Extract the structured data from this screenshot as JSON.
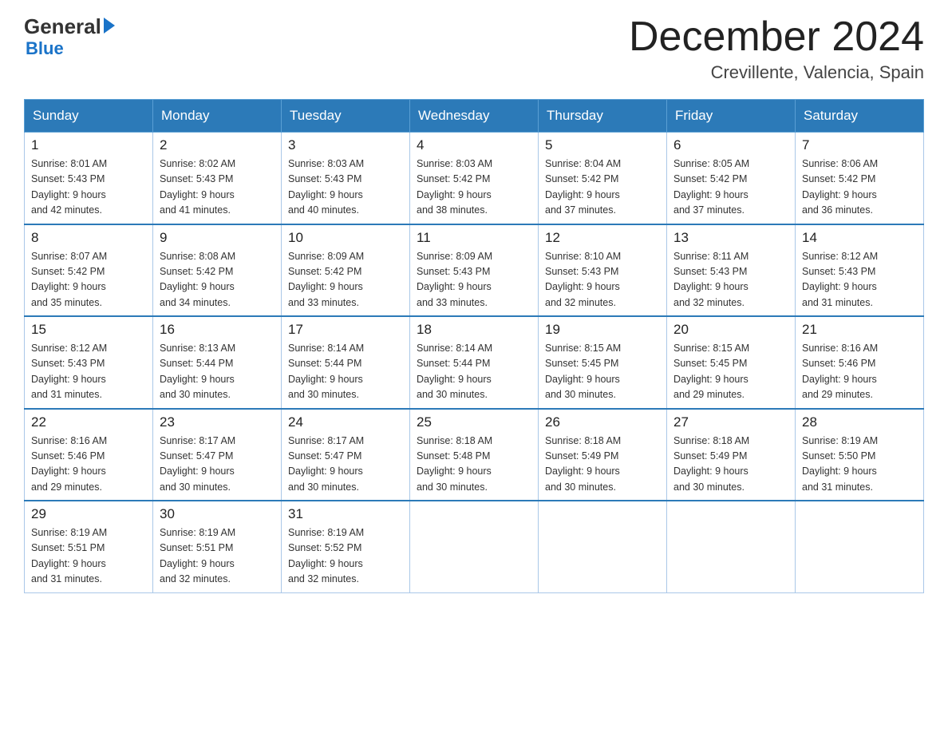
{
  "header": {
    "logo_general": "General",
    "logo_blue": "Blue",
    "month_title": "December 2024",
    "location": "Crevillente, Valencia, Spain"
  },
  "weekdays": [
    "Sunday",
    "Monday",
    "Tuesday",
    "Wednesday",
    "Thursday",
    "Friday",
    "Saturday"
  ],
  "weeks": [
    [
      {
        "day": "1",
        "sunrise": "8:01 AM",
        "sunset": "5:43 PM",
        "daylight": "9 hours and 42 minutes."
      },
      {
        "day": "2",
        "sunrise": "8:02 AM",
        "sunset": "5:43 PM",
        "daylight": "9 hours and 41 minutes."
      },
      {
        "day": "3",
        "sunrise": "8:03 AM",
        "sunset": "5:43 PM",
        "daylight": "9 hours and 40 minutes."
      },
      {
        "day": "4",
        "sunrise": "8:03 AM",
        "sunset": "5:42 PM",
        "daylight": "9 hours and 38 minutes."
      },
      {
        "day": "5",
        "sunrise": "8:04 AM",
        "sunset": "5:42 PM",
        "daylight": "9 hours and 37 minutes."
      },
      {
        "day": "6",
        "sunrise": "8:05 AM",
        "sunset": "5:42 PM",
        "daylight": "9 hours and 37 minutes."
      },
      {
        "day": "7",
        "sunrise": "8:06 AM",
        "sunset": "5:42 PM",
        "daylight": "9 hours and 36 minutes."
      }
    ],
    [
      {
        "day": "8",
        "sunrise": "8:07 AM",
        "sunset": "5:42 PM",
        "daylight": "9 hours and 35 minutes."
      },
      {
        "day": "9",
        "sunrise": "8:08 AM",
        "sunset": "5:42 PM",
        "daylight": "9 hours and 34 minutes."
      },
      {
        "day": "10",
        "sunrise": "8:09 AM",
        "sunset": "5:42 PM",
        "daylight": "9 hours and 33 minutes."
      },
      {
        "day": "11",
        "sunrise": "8:09 AM",
        "sunset": "5:43 PM",
        "daylight": "9 hours and 33 minutes."
      },
      {
        "day": "12",
        "sunrise": "8:10 AM",
        "sunset": "5:43 PM",
        "daylight": "9 hours and 32 minutes."
      },
      {
        "day": "13",
        "sunrise": "8:11 AM",
        "sunset": "5:43 PM",
        "daylight": "9 hours and 32 minutes."
      },
      {
        "day": "14",
        "sunrise": "8:12 AM",
        "sunset": "5:43 PM",
        "daylight": "9 hours and 31 minutes."
      }
    ],
    [
      {
        "day": "15",
        "sunrise": "8:12 AM",
        "sunset": "5:43 PM",
        "daylight": "9 hours and 31 minutes."
      },
      {
        "day": "16",
        "sunrise": "8:13 AM",
        "sunset": "5:44 PM",
        "daylight": "9 hours and 30 minutes."
      },
      {
        "day": "17",
        "sunrise": "8:14 AM",
        "sunset": "5:44 PM",
        "daylight": "9 hours and 30 minutes."
      },
      {
        "day": "18",
        "sunrise": "8:14 AM",
        "sunset": "5:44 PM",
        "daylight": "9 hours and 30 minutes."
      },
      {
        "day": "19",
        "sunrise": "8:15 AM",
        "sunset": "5:45 PM",
        "daylight": "9 hours and 30 minutes."
      },
      {
        "day": "20",
        "sunrise": "8:15 AM",
        "sunset": "5:45 PM",
        "daylight": "9 hours and 29 minutes."
      },
      {
        "day": "21",
        "sunrise": "8:16 AM",
        "sunset": "5:46 PM",
        "daylight": "9 hours and 29 minutes."
      }
    ],
    [
      {
        "day": "22",
        "sunrise": "8:16 AM",
        "sunset": "5:46 PM",
        "daylight": "9 hours and 29 minutes."
      },
      {
        "day": "23",
        "sunrise": "8:17 AM",
        "sunset": "5:47 PM",
        "daylight": "9 hours and 30 minutes."
      },
      {
        "day": "24",
        "sunrise": "8:17 AM",
        "sunset": "5:47 PM",
        "daylight": "9 hours and 30 minutes."
      },
      {
        "day": "25",
        "sunrise": "8:18 AM",
        "sunset": "5:48 PM",
        "daylight": "9 hours and 30 minutes."
      },
      {
        "day": "26",
        "sunrise": "8:18 AM",
        "sunset": "5:49 PM",
        "daylight": "9 hours and 30 minutes."
      },
      {
        "day": "27",
        "sunrise": "8:18 AM",
        "sunset": "5:49 PM",
        "daylight": "9 hours and 30 minutes."
      },
      {
        "day": "28",
        "sunrise": "8:19 AM",
        "sunset": "5:50 PM",
        "daylight": "9 hours and 31 minutes."
      }
    ],
    [
      {
        "day": "29",
        "sunrise": "8:19 AM",
        "sunset": "5:51 PM",
        "daylight": "9 hours and 31 minutes."
      },
      {
        "day": "30",
        "sunrise": "8:19 AM",
        "sunset": "5:51 PM",
        "daylight": "9 hours and 32 minutes."
      },
      {
        "day": "31",
        "sunrise": "8:19 AM",
        "sunset": "5:52 PM",
        "daylight": "9 hours and 32 minutes."
      },
      null,
      null,
      null,
      null
    ]
  ]
}
